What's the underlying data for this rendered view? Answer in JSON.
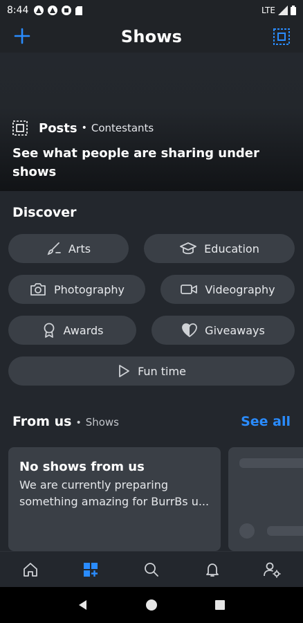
{
  "status_bar": {
    "time": "8:44",
    "network": "LTE"
  },
  "header": {
    "title": "Shows"
  },
  "hero": {
    "posts_label": "Posts",
    "separator": "•",
    "subtitle": "Contestants",
    "headline": "See what people are sharing under shows"
  },
  "discover": {
    "title": "Discover",
    "chips": [
      {
        "label": "Arts",
        "icon": "brush-icon"
      },
      {
        "label": "Education",
        "icon": "graduation-cap-icon"
      },
      {
        "label": "Photography",
        "icon": "camera-icon"
      },
      {
        "label": "Videography",
        "icon": "video-camera-icon"
      },
      {
        "label": "Awards",
        "icon": "award-icon"
      },
      {
        "label": "Giveaways",
        "icon": "heart-half-icon"
      },
      {
        "label": "Fun time",
        "icon": "play-icon"
      }
    ]
  },
  "from_us": {
    "title": "From us",
    "separator": "•",
    "subtitle": "Shows",
    "see_all": "See all",
    "card": {
      "title": "No shows from us",
      "description": "We are currently preparing something amazing for BurrBs u..."
    }
  },
  "bottom_nav": {
    "items": [
      {
        "name": "home",
        "icon": "home-icon",
        "active": false
      },
      {
        "name": "shows",
        "icon": "shows-grid-icon",
        "active": true
      },
      {
        "name": "search",
        "icon": "search-icon",
        "active": false
      },
      {
        "name": "notifications",
        "icon": "bell-icon",
        "active": false
      },
      {
        "name": "profile-settings",
        "icon": "user-settings-icon",
        "active": false
      }
    ]
  },
  "colors": {
    "accent": "#2a8cff",
    "background": "#23272d",
    "chip": "#3a3f46"
  }
}
